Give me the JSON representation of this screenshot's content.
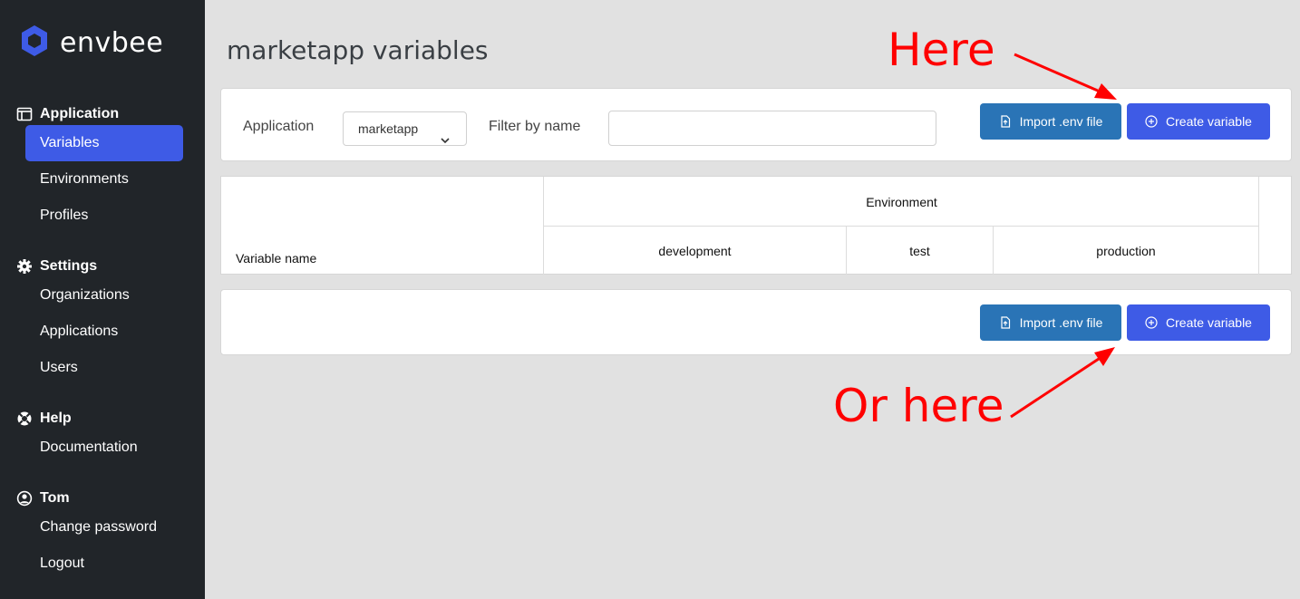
{
  "brand": {
    "name": "envbee",
    "logo_icon": "hexagon-logo-icon",
    "accent": "#3e5be6"
  },
  "sidebar": {
    "sections": [
      {
        "heading": "Application",
        "icon": "window-icon",
        "items": [
          "Variables",
          "Environments",
          "Profiles"
        ]
      },
      {
        "heading": "Settings",
        "icon": "gear-icon",
        "items": [
          "Organizations",
          "Applications",
          "Users"
        ]
      },
      {
        "heading": "Help",
        "icon": "lifebuoy-icon",
        "items": [
          "Documentation"
        ]
      },
      {
        "heading": "Tom",
        "icon": "user-circle-icon",
        "items": [
          "Change password",
          "Logout"
        ]
      }
    ],
    "active_item": "Variables"
  },
  "page": {
    "title": "marketapp variables"
  },
  "filters": {
    "application_label": "Application",
    "application_value": "marketapp",
    "filter_label": "Filter by name",
    "filter_value": ""
  },
  "buttons": {
    "import_label": "Import .env file",
    "create_label": "Create variable",
    "import_color": "#2a74b6",
    "create_color": "#3e5be6"
  },
  "table": {
    "variable_header": "Variable name",
    "group_header": "Environment",
    "environments": [
      "development",
      "test",
      "production"
    ]
  },
  "annotations": {
    "top": "Here",
    "bottom": "Or here",
    "color": "#ff0000"
  }
}
